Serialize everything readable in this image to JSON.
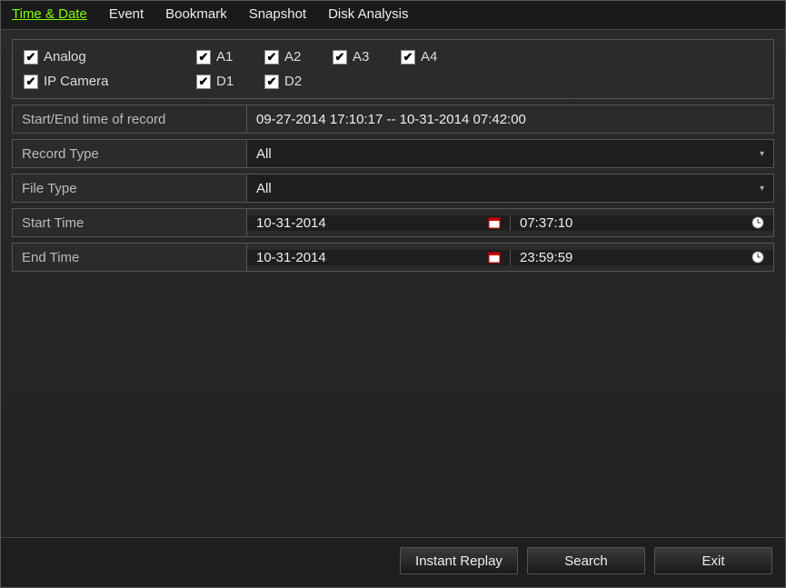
{
  "tabs": {
    "time_date": "Time & Date",
    "event": "Event",
    "bookmark": "Bookmark",
    "snapshot": "Snapshot",
    "disk_analysis": "Disk Analysis"
  },
  "channels": {
    "analog_label": "Analog",
    "ip_label": "IP Camera",
    "a1": "A1",
    "a2": "A2",
    "a3": "A3",
    "a4": "A4",
    "d1": "D1",
    "d2": "D2"
  },
  "form": {
    "range_label": "Start/End time of record",
    "range_value": "09-27-2014 17:10:17 -- 10-31-2014 07:42:00",
    "record_type_label": "Record Type",
    "record_type_value": "All",
    "file_type_label": "File Type",
    "file_type_value": "All",
    "start_time_label": "Start Time",
    "start_date_value": "10-31-2014",
    "start_time_value": "07:37:10",
    "end_time_label": "End Time",
    "end_date_value": "10-31-2014",
    "end_time_value": "23:59:59"
  },
  "buttons": {
    "instant_replay": "Instant Replay",
    "search": "Search",
    "exit": "Exit"
  }
}
